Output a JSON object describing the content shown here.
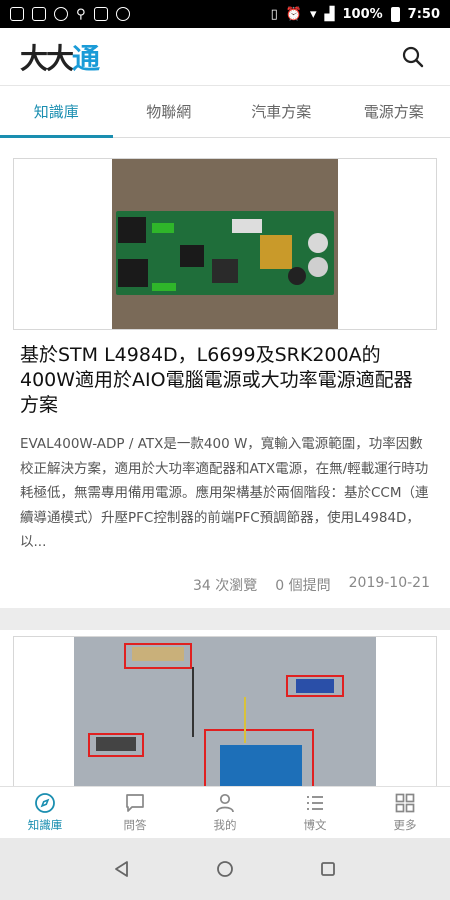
{
  "status_bar": {
    "battery_text": "100%",
    "time": "7:50"
  },
  "header": {
    "logo_part1": "大大",
    "logo_part2": "通"
  },
  "tabs": [
    {
      "label": "知識庫",
      "active": true
    },
    {
      "label": "物聯網",
      "active": false
    },
    {
      "label": "汽車方案",
      "active": false
    },
    {
      "label": "電源方案",
      "active": false
    }
  ],
  "articles": [
    {
      "title": "基於STM L4984D，L6699及SRK200A的400W適用於AIO電腦電源或大功率電源適配器方案",
      "excerpt": "EVAL400W-ADP / ATX是一款400 W，寬輸入電源範圍，功率因數校正解決方案，適用於大功率適配器和ATX電源，在無/輕載運行時功耗極低，無需專用備用電源。應用架構基於兩個階段：基於CCM（連續導通模式）升壓PFC控制器的前端PFC預調節器，使用L4984D，以...",
      "views": "34 次瀏覽",
      "questions": "0 個提問",
      "date": "2019-10-21"
    }
  ],
  "bottom_nav": [
    {
      "label": "知識庫",
      "icon": "compass-icon",
      "active": true
    },
    {
      "label": "問答",
      "icon": "chat-icon",
      "active": false
    },
    {
      "label": "我的",
      "icon": "person-icon",
      "active": false
    },
    {
      "label": "博文",
      "icon": "list-icon",
      "active": false
    },
    {
      "label": "更多",
      "icon": "grid-icon",
      "active": false
    }
  ],
  "colors": {
    "accent": "#1a8eb0",
    "logo_blue": "#1a9bd7"
  }
}
